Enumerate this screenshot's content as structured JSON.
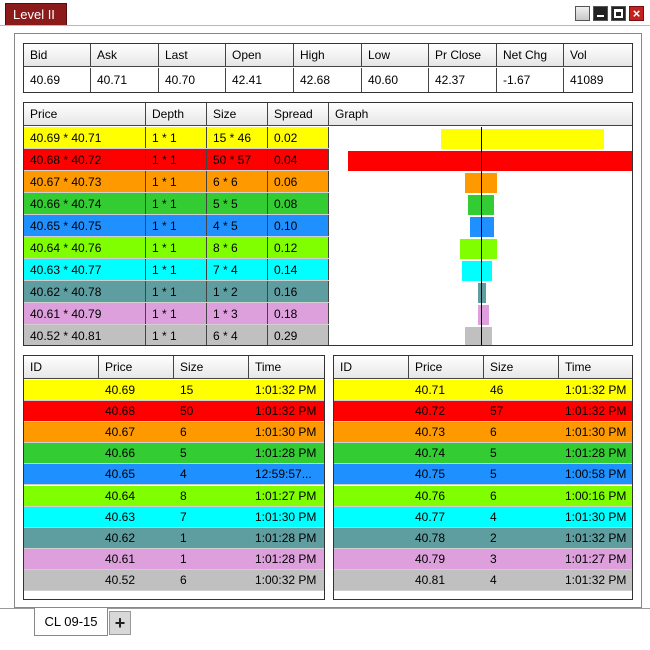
{
  "window": {
    "title": "Level II"
  },
  "summary": {
    "headers": [
      "Bid",
      "Ask",
      "Last",
      "Open",
      "High",
      "Low",
      "Pr Close",
      "Net Chg",
      "Vol"
    ],
    "values": [
      "40.69",
      "40.71",
      "40.70",
      "42.41",
      "42.68",
      "40.60",
      "42.37",
      "-1.67",
      "41089"
    ]
  },
  "depth": {
    "headers": [
      "Price",
      "Depth",
      "Size",
      "Spread",
      "Graph"
    ],
    "rows": [
      {
        "price": "40.69 * 40.71",
        "depth": "1 * 1",
        "size": "15 * 46",
        "spread": "0.02",
        "color": "#ffff00",
        "bid_size": 15,
        "ask_size": 46
      },
      {
        "price": "40.68 * 40.72",
        "depth": "1 * 1",
        "size": "50 * 57",
        "spread": "0.04",
        "color": "#ff0000",
        "bid_size": 50,
        "ask_size": 57
      },
      {
        "price": "40.67 * 40.73",
        "depth": "1 * 1",
        "size": "6 * 6",
        "spread": "0.06",
        "color": "#ff9900",
        "bid_size": 6,
        "ask_size": 6
      },
      {
        "price": "40.66 * 40.74",
        "depth": "1 * 1",
        "size": "5 * 5",
        "spread": "0.08",
        "color": "#33cc33",
        "bid_size": 5,
        "ask_size": 5
      },
      {
        "price": "40.65 * 40.75",
        "depth": "1 * 1",
        "size": "4 * 5",
        "spread": "0.10",
        "color": "#1e90ff",
        "bid_size": 4,
        "ask_size": 5
      },
      {
        "price": "40.64 * 40.76",
        "depth": "1 * 1",
        "size": "8 * 6",
        "spread": "0.12",
        "color": "#80ff00",
        "bid_size": 8,
        "ask_size": 6
      },
      {
        "price": "40.63 * 40.77",
        "depth": "1 * 1",
        "size": "7 * 4",
        "spread": "0.14",
        "color": "#00ffff",
        "bid_size": 7,
        "ask_size": 4
      },
      {
        "price": "40.62 * 40.78",
        "depth": "1 * 1",
        "size": "1 * 2",
        "spread": "0.16",
        "color": "#5f9ea0",
        "bid_size": 1,
        "ask_size": 2
      },
      {
        "price": "40.61 * 40.79",
        "depth": "1 * 1",
        "size": "1 * 3",
        "spread": "0.18",
        "color": "#dda0dd",
        "bid_size": 1,
        "ask_size": 3
      },
      {
        "price": "40.52 * 40.81",
        "depth": "1 * 1",
        "size": "6 * 4",
        "spread": "0.29",
        "color": "#c0c0c0",
        "bid_size": 6,
        "ask_size": 4
      }
    ]
  },
  "bids": {
    "headers": [
      "ID",
      "Price",
      "Size",
      "Time"
    ],
    "rows": [
      {
        "id": "",
        "price": "40.69",
        "size": "15",
        "time": "1:01:32 PM",
        "color": "#ffff00"
      },
      {
        "id": "",
        "price": "40.68",
        "size": "50",
        "time": "1:01:32 PM",
        "color": "#ff0000"
      },
      {
        "id": "",
        "price": "40.67",
        "size": "6",
        "time": "1:01:30 PM",
        "color": "#ff9900"
      },
      {
        "id": "",
        "price": "40.66",
        "size": "5",
        "time": "1:01:28 PM",
        "color": "#33cc33"
      },
      {
        "id": "",
        "price": "40.65",
        "size": "4",
        "time": "12:59:57...",
        "color": "#1e90ff"
      },
      {
        "id": "",
        "price": "40.64",
        "size": "8",
        "time": "1:01:27 PM",
        "color": "#80ff00"
      },
      {
        "id": "",
        "price": "40.63",
        "size": "7",
        "time": "1:01:30 PM",
        "color": "#00ffff"
      },
      {
        "id": "",
        "price": "40.62",
        "size": "1",
        "time": "1:01:28 PM",
        "color": "#5f9ea0"
      },
      {
        "id": "",
        "price": "40.61",
        "size": "1",
        "time": "1:01:28 PM",
        "color": "#dda0dd"
      },
      {
        "id": "",
        "price": "40.52",
        "size": "6",
        "time": "1:00:32 PM",
        "color": "#c0c0c0"
      }
    ]
  },
  "asks": {
    "headers": [
      "ID",
      "Price",
      "Size",
      "Time"
    ],
    "rows": [
      {
        "id": "",
        "price": "40.71",
        "size": "46",
        "time": "1:01:32 PM",
        "color": "#ffff00"
      },
      {
        "id": "",
        "price": "40.72",
        "size": "57",
        "time": "1:01:32 PM",
        "color": "#ff0000"
      },
      {
        "id": "",
        "price": "40.73",
        "size": "6",
        "time": "1:01:30 PM",
        "color": "#ff9900"
      },
      {
        "id": "",
        "price": "40.74",
        "size": "5",
        "time": "1:01:28 PM",
        "color": "#33cc33"
      },
      {
        "id": "",
        "price": "40.75",
        "size": "5",
        "time": "1:00:58 PM",
        "color": "#1e90ff"
      },
      {
        "id": "",
        "price": "40.76",
        "size": "6",
        "time": "1:00:16 PM",
        "color": "#80ff00"
      },
      {
        "id": "",
        "price": "40.77",
        "size": "4",
        "time": "1:01:30 PM",
        "color": "#00ffff"
      },
      {
        "id": "",
        "price": "40.78",
        "size": "2",
        "time": "1:01:32 PM",
        "color": "#5f9ea0"
      },
      {
        "id": "",
        "price": "40.79",
        "size": "3",
        "time": "1:01:27 PM",
        "color": "#dda0dd"
      },
      {
        "id": "",
        "price": "40.81",
        "size": "4",
        "time": "1:01:32 PM",
        "color": "#c0c0c0"
      }
    ]
  },
  "tabs": [
    {
      "label": "CL 09-15"
    }
  ],
  "add_tab_label": "+"
}
